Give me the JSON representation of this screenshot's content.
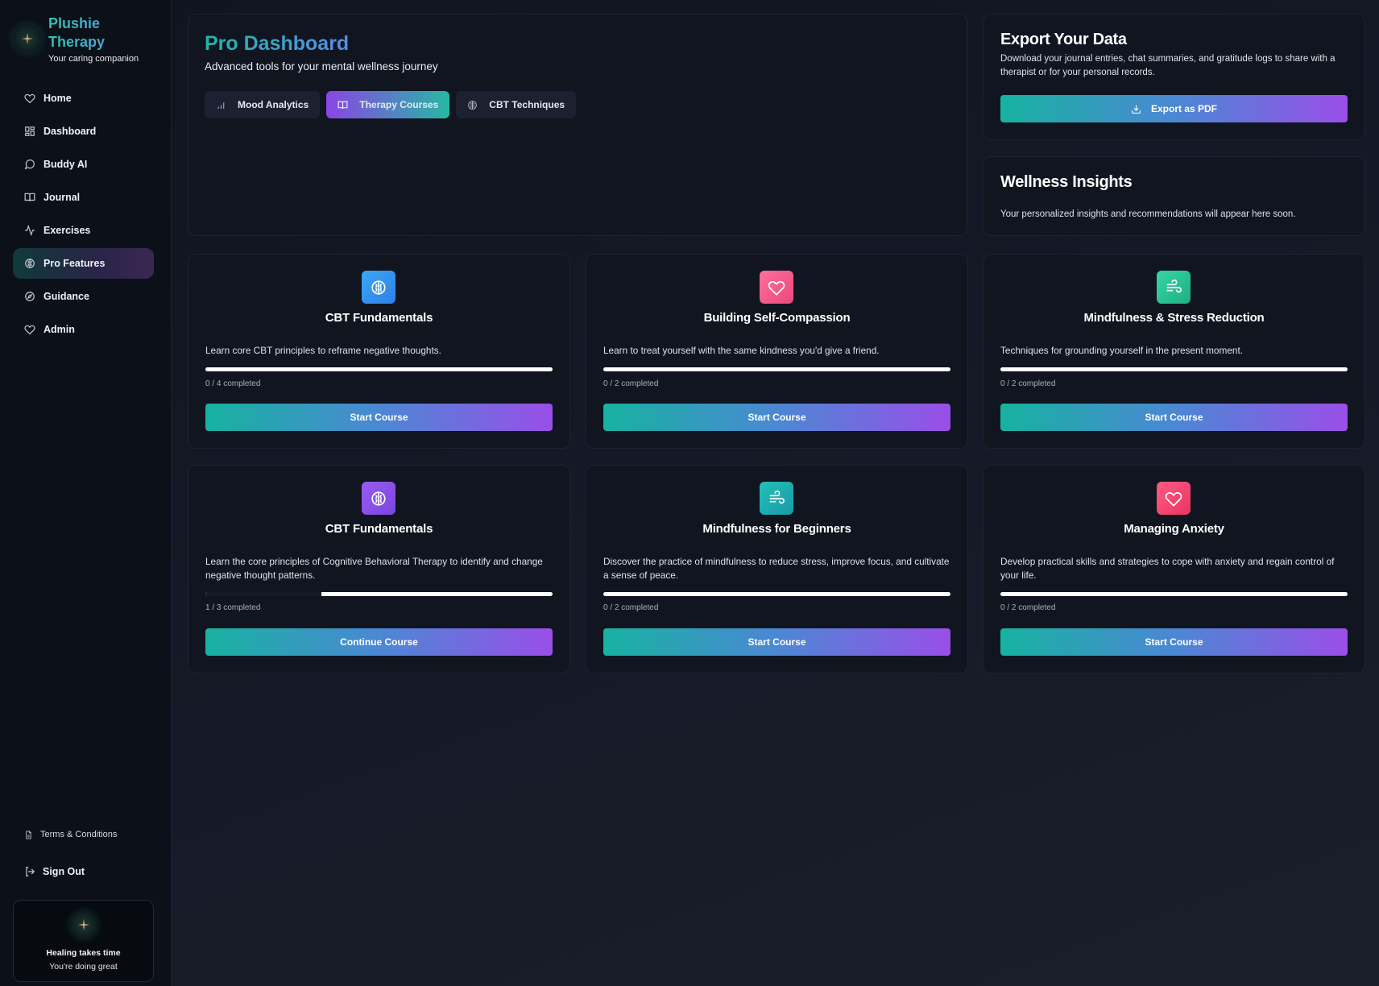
{
  "brand": {
    "title": "Plushie Therapy",
    "subtitle": "Your caring companion"
  },
  "nav": [
    {
      "label": "Home",
      "icon": "heart-icon"
    },
    {
      "label": "Dashboard",
      "icon": "dashboard-icon"
    },
    {
      "label": "Buddy AI",
      "icon": "chat-icon"
    },
    {
      "label": "Journal",
      "icon": "book-icon"
    },
    {
      "label": "Exercises",
      "icon": "activity-icon"
    },
    {
      "label": "Pro Features",
      "icon": "brain-icon",
      "active": true
    },
    {
      "label": "Guidance",
      "icon": "compass-icon"
    },
    {
      "label": "Admin",
      "icon": "heart-icon"
    }
  ],
  "footer": {
    "terms": "Terms & Conditions",
    "signout": "Sign Out",
    "encourage_line1": "Healing takes time",
    "encourage_line2": "You're doing great"
  },
  "hero": {
    "title": "Pro Dashboard",
    "subtitle": "Advanced tools for your mental wellness journey",
    "tabs": [
      {
        "label": "Mood Analytics",
        "icon": "bar-chart-icon"
      },
      {
        "label": "Therapy Courses",
        "icon": "book-icon",
        "active": true
      },
      {
        "label": "CBT Techniques",
        "icon": "brain-icon"
      }
    ]
  },
  "export": {
    "title": "Export Your Data",
    "text": "Download your journal entries, chat summaries, and gratitude logs to share with a therapist or for your personal records.",
    "button": "Export as PDF"
  },
  "insights": {
    "title": "Wellness Insights",
    "text": "Your personalized insights and recommendations will appear here soon."
  },
  "courses": [
    {
      "title": "CBT Fundamentals",
      "desc": "Learn core CBT principles to reframe negative thoughts.",
      "completed": 0,
      "total": 4,
      "count_text": "0 / 4 completed",
      "button": "Start Course",
      "icon": "brain-icon",
      "color": "#3aa0f0"
    },
    {
      "title": "Building Self-Compassion",
      "desc": "Learn to treat yourself with the same kindness you'd give a friend.",
      "completed": 0,
      "total": 2,
      "count_text": "0 / 2 completed",
      "button": "Start Course",
      "icon": "heart-icon",
      "color": "#f0508a"
    },
    {
      "title": "Mindfulness & Stress Reduction",
      "desc": "Techniques for grounding yourself in the present moment.",
      "completed": 0,
      "total": 2,
      "count_text": "0 / 2 completed",
      "button": "Start Course",
      "icon": "wind-icon",
      "color": "#2ec79a"
    },
    {
      "title": "CBT Fundamentals",
      "desc": "Learn the core principles of Cognitive Behavioral Therapy to identify and change negative thought patterns.",
      "completed": 1,
      "total": 3,
      "count_text": "1 / 3 completed",
      "button": "Continue Course",
      "icon": "brain-icon",
      "color": "#8a55ea"
    },
    {
      "title": "Mindfulness for Beginners",
      "desc": "Discover the practice of mindfulness to reduce stress, improve focus, and cultivate a sense of peace.",
      "completed": 0,
      "total": 2,
      "count_text": "0 / 2 completed",
      "button": "Start Course",
      "icon": "wind-icon",
      "color": "#1fb0b0"
    },
    {
      "title": "Managing Anxiety",
      "desc": "Develop practical skills and strategies to cope with anxiety and regain control of your life.",
      "completed": 0,
      "total": 2,
      "count_text": "0 / 2 completed",
      "button": "Start Course",
      "icon": "heart-icon",
      "color": "#f0406e"
    }
  ]
}
